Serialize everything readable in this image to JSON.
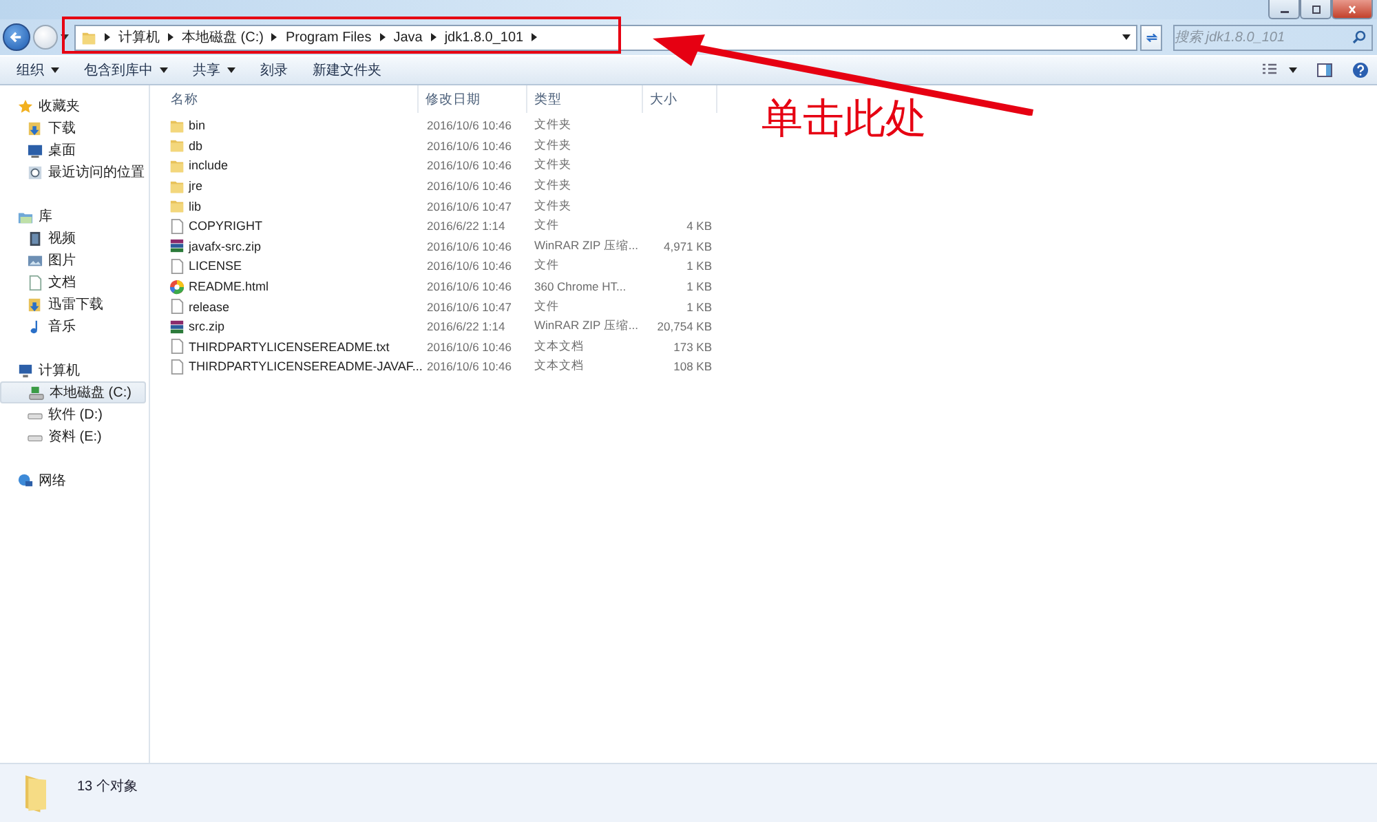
{
  "address_bar": {
    "crumbs": [
      "计算机",
      "本地磁盘 (C:)",
      "Program Files",
      "Java",
      "jdk1.8.0_101"
    ]
  },
  "search": {
    "placeholder": "搜索 jdk1.8.0_101"
  },
  "toolbar": [
    {
      "label": "组织",
      "has_menu": true
    },
    {
      "label": "包含到库中",
      "has_menu": true
    },
    {
      "label": "共享",
      "has_menu": true
    },
    {
      "label": "刻录",
      "has_menu": false
    },
    {
      "label": "新建文件夹",
      "has_menu": false
    }
  ],
  "sidebar": [
    {
      "label": "收藏夹",
      "kind": "star",
      "selected": false,
      "children": [
        {
          "label": "下载",
          "kind": "download",
          "selected": false
        },
        {
          "label": "桌面",
          "kind": "desktop",
          "selected": false
        },
        {
          "label": "最近访问的位置",
          "kind": "recent",
          "selected": false
        }
      ]
    },
    {
      "label": "库",
      "kind": "library",
      "selected": false,
      "children": [
        {
          "label": "视频",
          "kind": "video",
          "selected": false
        },
        {
          "label": "图片",
          "kind": "image",
          "selected": false
        },
        {
          "label": "文档",
          "kind": "doc",
          "selected": false
        },
        {
          "label": "迅雷下载",
          "kind": "download",
          "selected": false
        },
        {
          "label": "音乐",
          "kind": "music",
          "selected": false
        }
      ]
    },
    {
      "label": "计算机",
      "kind": "computer",
      "selected": false,
      "children": [
        {
          "label": "本地磁盘 (C:)",
          "kind": "sysdrive",
          "selected": true
        },
        {
          "label": "软件 (D:)",
          "kind": "drive",
          "selected": false
        },
        {
          "label": "资料 (E:)",
          "kind": "drive",
          "selected": false
        }
      ]
    },
    {
      "label": "网络",
      "kind": "network",
      "selected": false
    }
  ],
  "table": {
    "columns": [
      "名称",
      "修改日期",
      "类型",
      "大小"
    ],
    "rows": [
      {
        "kind": "folder",
        "name": "bin",
        "date": "2016/10/6 10:46",
        "type": "文件夹"
      },
      {
        "kind": "folder",
        "name": "db",
        "date": "2016/10/6 10:46",
        "type": "文件夹"
      },
      {
        "kind": "folder",
        "name": "include",
        "date": "2016/10/6 10:46",
        "type": "文件夹"
      },
      {
        "kind": "folder",
        "name": "jre",
        "date": "2016/10/6 10:46",
        "type": "文件夹"
      },
      {
        "kind": "folder",
        "name": "lib",
        "date": "2016/10/6 10:47",
        "type": "文件夹"
      },
      {
        "kind": "file",
        "name": "COPYRIGHT",
        "date": "2016/6/22 1:14",
        "type": "文件",
        "size": "4 KB"
      },
      {
        "kind": "zip",
        "name": "javafx-src.zip",
        "date": "2016/10/6 10:46",
        "type": "WinRAR ZIP 压缩...",
        "size": "4,971 KB"
      },
      {
        "kind": "file",
        "name": "LICENSE",
        "date": "2016/10/6 10:46",
        "type": "文件",
        "size": "1 KB"
      },
      {
        "kind": "html",
        "name": "README.html",
        "date": "2016/10/6 10:46",
        "type": "360 Chrome HT...",
        "size": "1 KB"
      },
      {
        "kind": "file",
        "name": "release",
        "date": "2016/10/6 10:47",
        "type": "文件",
        "size": "1 KB"
      },
      {
        "kind": "zip",
        "name": "src.zip",
        "date": "2016/6/22 1:14",
        "type": "WinRAR ZIP 压缩...",
        "size": "20,754 KB"
      },
      {
        "kind": "file",
        "name": "THIRDPARTYLICENSEREADME.txt",
        "date": "2016/10/6 10:46",
        "type": "文本文档",
        "size": "173 KB"
      },
      {
        "kind": "file",
        "name": "THIRDPARTYLICENSEREADME-JAVAF...",
        "date": "2016/10/6 10:46",
        "type": "文本文档",
        "size": "108 KB"
      }
    ]
  },
  "status_bar": {
    "count": "13 个对象"
  },
  "annotation": {
    "text": "单击此处"
  }
}
